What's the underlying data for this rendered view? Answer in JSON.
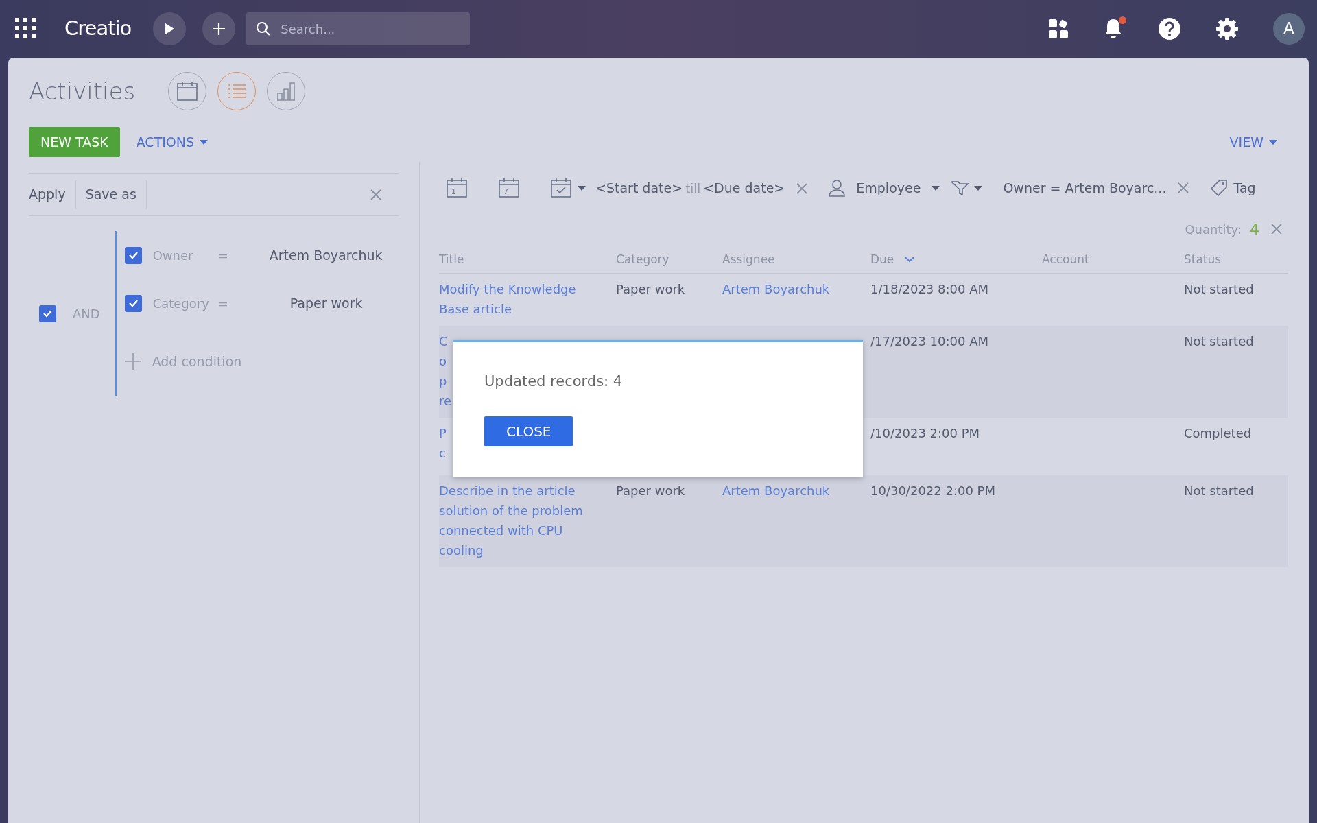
{
  "top_bar": {
    "logo": "Creatio",
    "search": {
      "placeholder": "Search..."
    },
    "notification_dot": true,
    "avatar": "A"
  },
  "page": {
    "title": "Activities",
    "views": [
      {
        "kind": "calendar",
        "selected": false
      },
      {
        "kind": "list",
        "selected": true
      },
      {
        "kind": "chart",
        "selected": false
      }
    ]
  },
  "actions": {
    "new_task": "NEW TASK",
    "actions": "ACTIONS",
    "view": "VIEW"
  },
  "filter_panel": {
    "apply": "Apply",
    "save_as": "Save as",
    "group": {
      "operator": "AND",
      "checked": true,
      "conditions": [
        {
          "field": "Owner",
          "op": "=",
          "value": "Artem Boyarchuk",
          "checked": true
        },
        {
          "field": "Category",
          "op": "=",
          "value": "Paper work",
          "checked": true
        }
      ],
      "add": "Add condition"
    }
  },
  "quick_filters": {
    "day": "1",
    "week": "7",
    "start": "<Start date>",
    "sep": "till",
    "end": "<Due date>",
    "employee": "Employee",
    "owner_filter": "Owner = Artem Boyarc...",
    "tag": "Tag",
    "quantity_label": "Quantity:",
    "quantity": "4"
  },
  "table": {
    "columns": [
      {
        "label": "Title",
        "sorted": false
      },
      {
        "label": "Category",
        "sorted": false
      },
      {
        "label": "Assignee",
        "sorted": false
      },
      {
        "label": "Due",
        "sorted": true
      },
      {
        "label": "Account",
        "sorted": false
      },
      {
        "label": "Status",
        "sorted": false
      }
    ],
    "rows": [
      {
        "title_lines": [
          "Modify the Knowledge",
          "Base article"
        ],
        "category": "Paper work",
        "assignee": "Artem Boyarchuk",
        "due": "1/18/2023 8:00 AM",
        "status": "Not started"
      },
      {
        "title_lines": [
          "C",
          "o",
          "p",
          "re"
        ],
        "due": "/17/2023 10:00 AM",
        "status": "Not started"
      },
      {
        "title_lines": [
          "P",
          "c"
        ],
        "due": "/10/2023 2:00 PM",
        "status": "Completed"
      },
      {
        "title_lines": [
          "Describe in the article",
          "solution of the problem",
          "connected with CPU",
          "cooling"
        ],
        "category": "Paper work",
        "assignee": "Artem Boyarchuk",
        "due": "10/30/2022 2:00 PM",
        "status": "Not started"
      }
    ]
  },
  "dialog": {
    "message": "Updated records: 4",
    "button": "CLOSE"
  }
}
